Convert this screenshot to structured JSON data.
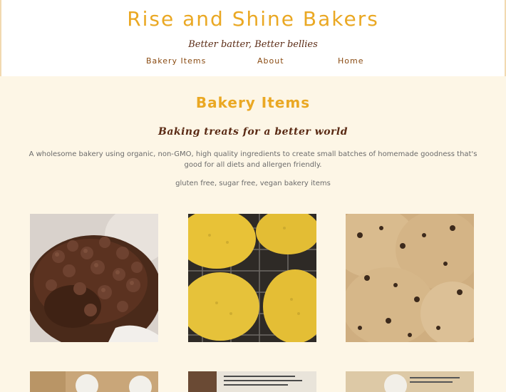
{
  "header": {
    "title": "Rise and Shine Bakers",
    "tagline": "Better batter, Better bellies",
    "nav": [
      {
        "label": "Bakery Items"
      },
      {
        "label": "About"
      },
      {
        "label": "Home"
      }
    ]
  },
  "main": {
    "heading": "Bakery Items",
    "subheading": "Baking treats for a better world",
    "description": "A wholesome bakery using organic, non-GMO, high quality ingredients to create small batches of homemade goodness that's good for all diets and allergen friendly.",
    "subline": "gluten free, sugar free, vegan bakery items"
  },
  "gallery": [
    {
      "subject": "chocolate muffin with chocolate chips"
    },
    {
      "subject": "corn muffins on cooling rack"
    },
    {
      "subject": "chocolate chip cookies"
    },
    {
      "subject": "packaged bakery item"
    },
    {
      "subject": "packaged bakery item"
    },
    {
      "subject": "packaged bakery item"
    }
  ],
  "colors": {
    "accent": "#eaa823",
    "brown": "#5a2a14",
    "background": "#fdf6e6"
  }
}
